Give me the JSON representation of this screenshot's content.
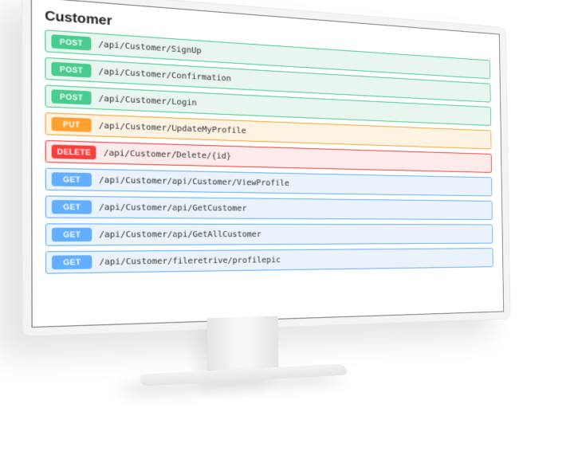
{
  "section": {
    "title": "Customer"
  },
  "methods": {
    "post": "POST",
    "put": "PUT",
    "delete": "DELETE",
    "get": "GET"
  },
  "endpoints": [
    {
      "method": "post",
      "path": "/api/Customer/SignUp"
    },
    {
      "method": "post",
      "path": "/api/Customer/Confirmation"
    },
    {
      "method": "post",
      "path": "/api/Customer/Login"
    },
    {
      "method": "put",
      "path": "/api/Customer/UpdateMyProfile"
    },
    {
      "method": "delete",
      "path": "/api/Customer/Delete/{id}"
    },
    {
      "method": "get",
      "path": "/api/Customer/api/Customer/ViewProfile"
    },
    {
      "method": "get",
      "path": "/api/Customer/api/GetCustomer"
    },
    {
      "method": "get",
      "path": "/api/Customer/api/GetAllCustomer"
    },
    {
      "method": "get",
      "path": "/api/Customer/fileretrive/profilepic"
    }
  ]
}
